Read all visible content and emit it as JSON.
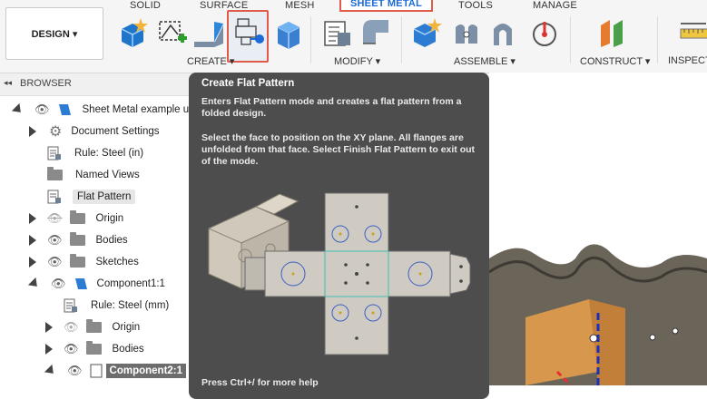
{
  "toolbar": {
    "tabs": [
      "SOLID",
      "SURFACE",
      "MESH",
      "SHEET METAL",
      "TOOLS",
      "MANAGE"
    ],
    "design_label": "DESIGN ▾",
    "groups": {
      "create": "CREATE ▾",
      "modify": "MODIFY ▾",
      "assemble": "ASSEMBLE ▾",
      "construct": "CONSTRUCT ▾",
      "inspect": "INSPECT"
    }
  },
  "browser": {
    "header": "BROWSER",
    "collapse_glyph": "◂◂",
    "items": [
      {
        "label": "Sheet Metal example usi"
      },
      {
        "label": "Document Settings"
      },
      {
        "label": "Rule: Steel (in)"
      },
      {
        "label": "Named Views"
      },
      {
        "label": "Flat Pattern"
      },
      {
        "label": "Origin"
      },
      {
        "label": "Bodies"
      },
      {
        "label": "Sketches"
      },
      {
        "label": "Component1:1"
      },
      {
        "label": "Rule: Steel (mm)"
      },
      {
        "label": "Origin"
      },
      {
        "label": "Bodies"
      },
      {
        "label": "Component2:1"
      }
    ]
  },
  "tooltip": {
    "title": "Create Flat Pattern",
    "p1": "Enters Flat Pattern mode and creates a flat pattern from a folded design.",
    "p2": "Select the face to position on the XY plane. All flanges are unfolded from that face. Select Finish Flat Pattern to exit out of the mode.",
    "footer": "Press Ctrl+/ for more help"
  },
  "colors": {
    "accent": "#1b6ad8",
    "highlight": "#e05a4a",
    "tooltip_bg": "#4d4d4d"
  }
}
